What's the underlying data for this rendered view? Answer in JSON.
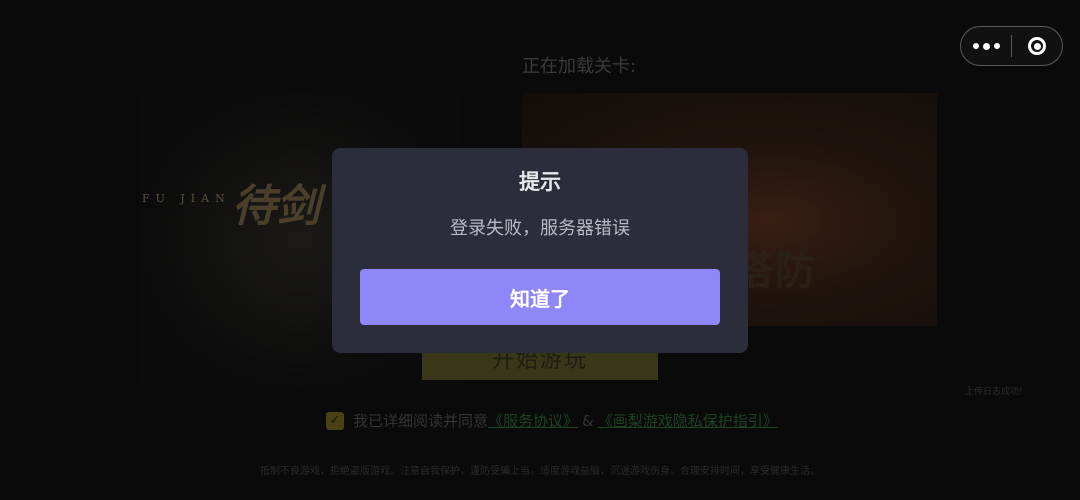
{
  "background": {
    "logo_text": "FU JIAN",
    "logo_glyph": "待剑",
    "loading_label": "正在加载关卡:",
    "banner_title": "塔防",
    "start_button_label": "开始游玩",
    "upload_status": "上传日志成功!",
    "agreement": {
      "checked": true,
      "prefix": "我已详细阅读并同意",
      "service_link": "《服务协议》",
      "amp": "&",
      "privacy_link": "《画梨游戏隐私保护指引》"
    },
    "health_notice": "抵制不良游戏，拒绝盗版游戏。注意自我保护，谨防受骗上当。适度游戏益脑，沉迷游戏伤身。合理安排时间，享受健康生活。"
  },
  "capsule": {
    "more_icon": "more-dots-icon",
    "close_icon": "close-target-icon"
  },
  "dialog": {
    "title": "提示",
    "message": "登录失败，服务器错误",
    "confirm_label": "知道了",
    "accent_color": "#8f86f8",
    "background_color": "#2b2d3a"
  }
}
